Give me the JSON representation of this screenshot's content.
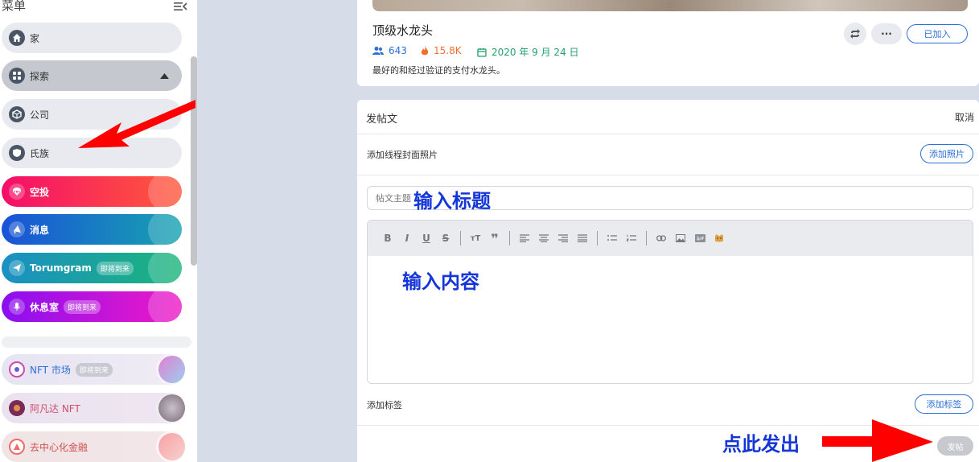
{
  "sidebar": {
    "title": "菜单",
    "items": [
      {
        "label": "家"
      },
      {
        "label": "探索"
      },
      {
        "label": "公司"
      },
      {
        "label": "氏族"
      },
      {
        "label": "空投"
      },
      {
        "label": "消息"
      },
      {
        "label": "Torumgram",
        "badge": "即将到来"
      },
      {
        "label": "休息室",
        "badge": "即将到来"
      },
      {
        "label": "NFT 市场",
        "badge": "即将到来"
      },
      {
        "label": "阿凡达 NFT"
      },
      {
        "label": "去中心化金融"
      }
    ]
  },
  "group": {
    "title": "顶级水龙头",
    "members": "643",
    "hot": "15.8K",
    "date": "2020 年 9 月 24 日",
    "description": "最好的和经过验证的支付水龙头。",
    "joined_label": "已加入",
    "more_label": "···"
  },
  "post": {
    "header": "发帖文",
    "cancel": "取消",
    "cover_label": "添加线程封面照片",
    "add_photo": "添加照片",
    "title_placeholder": "帖文主题",
    "tags_label": "添加标签",
    "add_tag": "添加标签",
    "publish": "发帖"
  },
  "annotations": {
    "enter_title": "输入标题",
    "enter_content": "输入内容",
    "click_publish": "点此发出"
  },
  "colors": {
    "accent": "#2d6fd6",
    "annotation": "#1436d8",
    "arrow": "#ff0000"
  }
}
